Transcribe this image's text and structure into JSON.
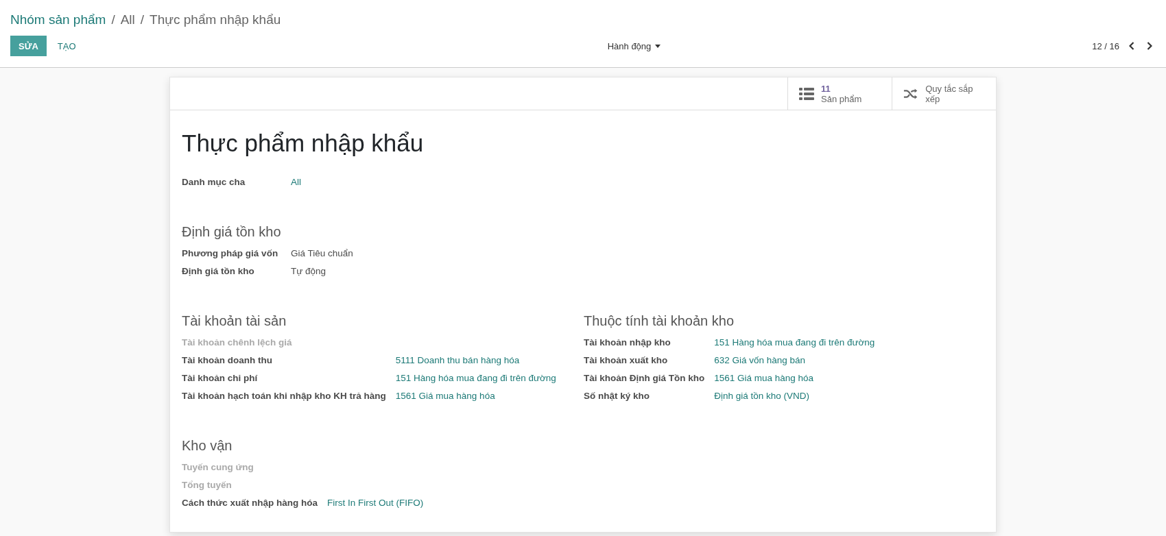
{
  "breadcrumb": [
    {
      "label": "Nhóm sản phẩm",
      "link": true
    },
    {
      "separator": "/",
      "label": "All",
      "link": false
    },
    {
      "separator": "/",
      "label": "Thực phẩm nhập khẩu",
      "link": false
    }
  ],
  "buttons": [
    {
      "label": "SỬA",
      "kind": "primary"
    },
    {
      "label": "TẠO",
      "kind": "link"
    }
  ],
  "action_menu": {
    "label": "Hành động"
  },
  "pager": {
    "text": "12 / 16"
  },
  "smart_buttons": [
    {
      "kind": "list",
      "count": "11",
      "label": "Sản phẩm"
    },
    {
      "kind": "shuffle",
      "label": "Quy tắc sắp xếp"
    }
  ],
  "title": "Thực phẩm nhập khẩu",
  "top_fields": [
    {
      "label": "Danh mục cha",
      "value": "All",
      "link": true
    }
  ],
  "sections": [
    {
      "title": "Định giá tồn kho",
      "columns": [
        {
          "fields": [
            {
              "label": "Phương pháp giá vốn",
              "value": "Giá Tiêu chuẩn",
              "link": false
            },
            {
              "label": "Định giá tồn kho",
              "value": "Tự động",
              "link": false
            }
          ]
        }
      ]
    },
    {
      "columns": [
        {
          "title": "Tài khoản tài sản",
          "fields": [
            {
              "label": "Tài khoản chênh lệch giá"
            },
            {
              "label": "Tài khoản doanh thu",
              "value": "5111 Doanh thu bán hàng hóa",
              "link": true
            },
            {
              "label": "Tài khoản chi phí",
              "value": "151 Hàng hóa mua đang đi trên đường",
              "link": true
            },
            {
              "label": "Tài khoản hạch toán khi nhập kho KH trả hàng",
              "value": "1561 Giá mua hàng hóa",
              "link": true
            }
          ]
        },
        {
          "title": "Thuộc tính tài khoản kho",
          "fields": [
            {
              "label": "Tài khoản nhập kho",
              "value": "151 Hàng hóa mua đang đi trên đường",
              "link": true
            },
            {
              "label": "Tài khoản xuất kho",
              "value": "632 Giá vốn hàng bán",
              "link": true
            },
            {
              "label": "Tài khoản Định giá Tồn kho",
              "value": "1561 Giá mua hàng hóa",
              "link": true
            },
            {
              "label": "Số nhật ký kho",
              "value": "Định giá tồn kho (VND)",
              "link": true
            }
          ]
        }
      ]
    },
    {
      "title": "Kho vận",
      "columns": [
        {
          "fields": [
            {
              "label": "Tuyến cung ứng"
            },
            {
              "label": "Tổng tuyến"
            },
            {
              "label": "Cách thức xuất nhập hàng hóa",
              "value": "First In First Out (FIFO)",
              "link": true
            }
          ]
        }
      ]
    }
  ]
}
